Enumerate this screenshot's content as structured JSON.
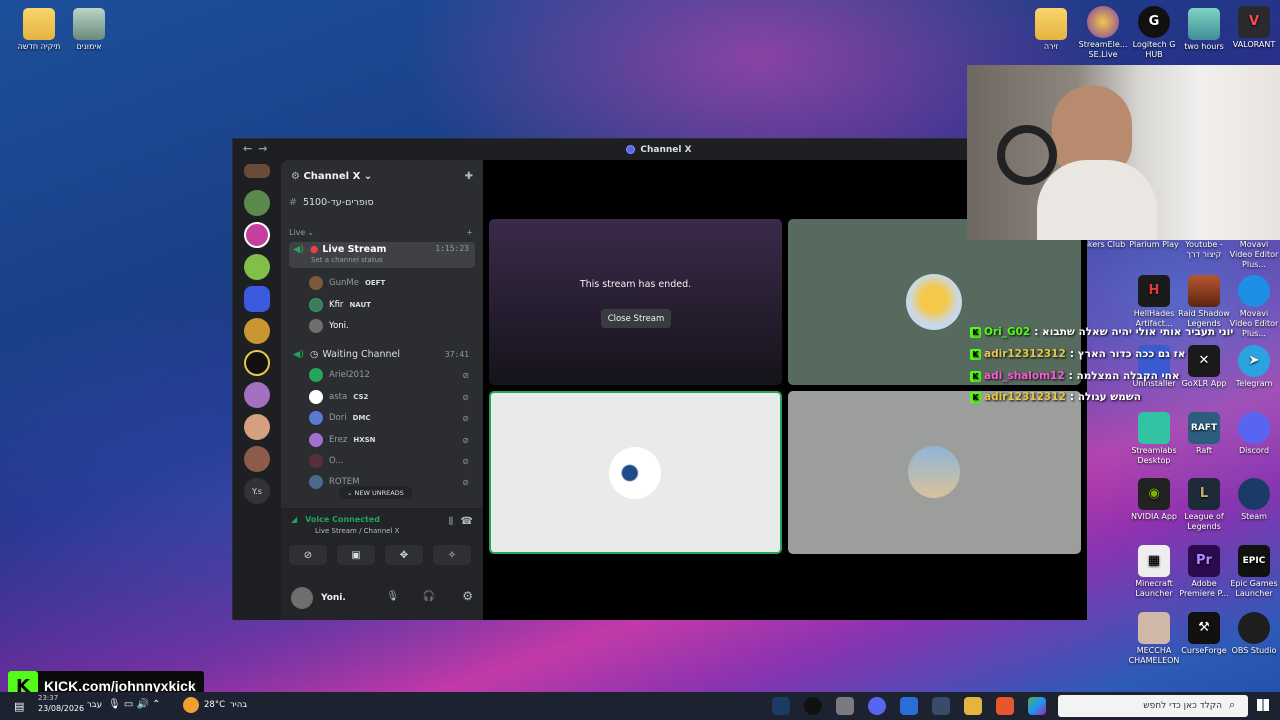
{
  "desktop_left": [
    {
      "label": "תיקיה חדשה"
    },
    {
      "label": "אימונים"
    }
  ],
  "desktop_top_right": [
    {
      "label": "זירה"
    },
    {
      "label": "StreamEle... SE.Live"
    },
    {
      "label": "Logitech G HUB"
    },
    {
      "label": "two hours"
    },
    {
      "label": "VALORANT"
    }
  ],
  "desktop_right_grid": [
    [
      "nkers Club",
      "Plarium Play",
      "Youtube - קיצור דרך",
      "Movavi Video Editor Plus..."
    ],
    [
      "HellHades Artifact...",
      "Raid Shadow Legends",
      "Movavi Video Editor Plus..."
    ],
    [
      "Uninstaller",
      "GoXLR App",
      "Telegram"
    ],
    [
      "Streamlabs Desktop",
      "Raft",
      "Discord"
    ],
    [
      "NVIDIA App",
      "League of Legends",
      "Steam"
    ],
    [
      "Minecraft Launcher",
      "Adobe Premiere P...",
      "Epic Games Launcher"
    ],
    [
      "MECCHA CHAMELEON",
      "CurseForge",
      "OBS Studio"
    ]
  ],
  "window": {
    "title": "Channel X"
  },
  "server": {
    "name": "Channel X"
  },
  "top_channel": "סופרים-עד-5100",
  "category": "Live",
  "live_stream": {
    "name": "Live Stream",
    "timer": "1:15:23",
    "status": "Set a channel status"
  },
  "live_members": [
    {
      "name": "GunMe",
      "tag": "OEFT"
    },
    {
      "name": "Kfir",
      "tag": "NAUT"
    },
    {
      "name": "Yoni.",
      "tag": ""
    }
  ],
  "waiting": {
    "name": "Waiting Channel",
    "timer": "37:41"
  },
  "waiting_members": [
    {
      "name": "Ariel2012",
      "tag": ""
    },
    {
      "name": "asta",
      "tag": "CS2"
    },
    {
      "name": "Dori",
      "tag": "DMC"
    },
    {
      "name": "Erez",
      "tag": "HXSN"
    },
    {
      "name": "O...",
      "tag": ""
    },
    {
      "name": "ROTEM",
      "tag": ""
    }
  ],
  "new_unreads": "NEW UNREADS",
  "voice": {
    "status": "Voice Connected",
    "location": "Live Stream / Channel X"
  },
  "user": {
    "name": "Yoni."
  },
  "stream": {
    "ended_text": "This stream has ended.",
    "close_label": "Close Stream"
  },
  "kick_chat": [
    {
      "user": "Ori_G02",
      "msg": ": יוני תעביר אותי אולי יהיה שאלה שתבוא",
      "color": "#53fc18"
    },
    {
      "user": "adir12312312",
      "msg": ": אז גם ככה כדור הארץ",
      "color": "#e6c84a"
    },
    {
      "user": "adi_shalom12",
      "msg": ": אחי הקבלה המצלמה",
      "color": "#ff5ad6"
    },
    {
      "user": "adir12312312",
      "msg": ": השמש עגולה",
      "color": "#e6c84a"
    }
  ],
  "kick_overlay": "KICK.com/johnnyxkick",
  "taskbar": {
    "time": "23:37",
    "date": "23/08/2026",
    "lang": "עבר",
    "weather_temp": "28°C",
    "weather_label": "בהיר",
    "search_placeholder": "הקלד כאן כדי לחפש"
  }
}
